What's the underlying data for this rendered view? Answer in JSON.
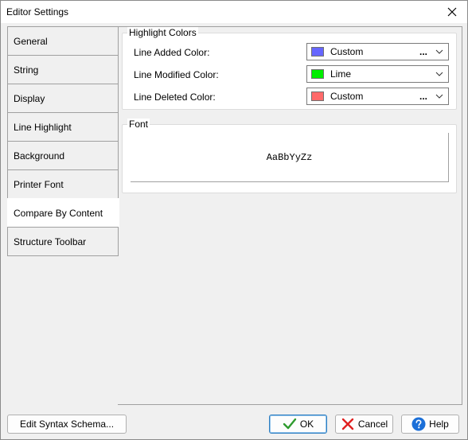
{
  "window": {
    "title": "Editor Settings"
  },
  "tabs": [
    {
      "label": "General",
      "active": false
    },
    {
      "label": "String",
      "active": false
    },
    {
      "label": "Display",
      "active": false
    },
    {
      "label": "Line Highlight",
      "active": false
    },
    {
      "label": "Background",
      "active": false
    },
    {
      "label": "Printer Font",
      "active": false
    },
    {
      "label": "Compare By Content",
      "active": true
    },
    {
      "label": "Structure Toolbar",
      "active": false
    }
  ],
  "highlight": {
    "title": "Highlight Colors",
    "rows": [
      {
        "label": "Line Added Color:",
        "value": "Custom",
        "swatch": "#6666ff",
        "has_ellipsis": true
      },
      {
        "label": "Line Modified Color:",
        "value": "Lime",
        "swatch": "#00ee00",
        "has_ellipsis": false
      },
      {
        "label": "Line Deleted Color:",
        "value": "Custom",
        "swatch": "#ff6a6a",
        "has_ellipsis": true
      }
    ],
    "ellipsis": "..."
  },
  "font": {
    "title": "Font",
    "preview": "AaBbYyZz"
  },
  "buttons": {
    "edit_schema": "Edit Syntax Schema...",
    "ok": "OK",
    "cancel": "Cancel",
    "help": "Help"
  },
  "icons": {
    "close": "close-icon",
    "ok": "checkmark-icon",
    "cancel": "x-icon",
    "help": "question-icon",
    "dropdown": "chevron-down-icon"
  },
  "colors": {
    "ok_check": "#2e9b2e",
    "cancel_x": "#e02020",
    "help_blue": "#1b6fd8"
  }
}
